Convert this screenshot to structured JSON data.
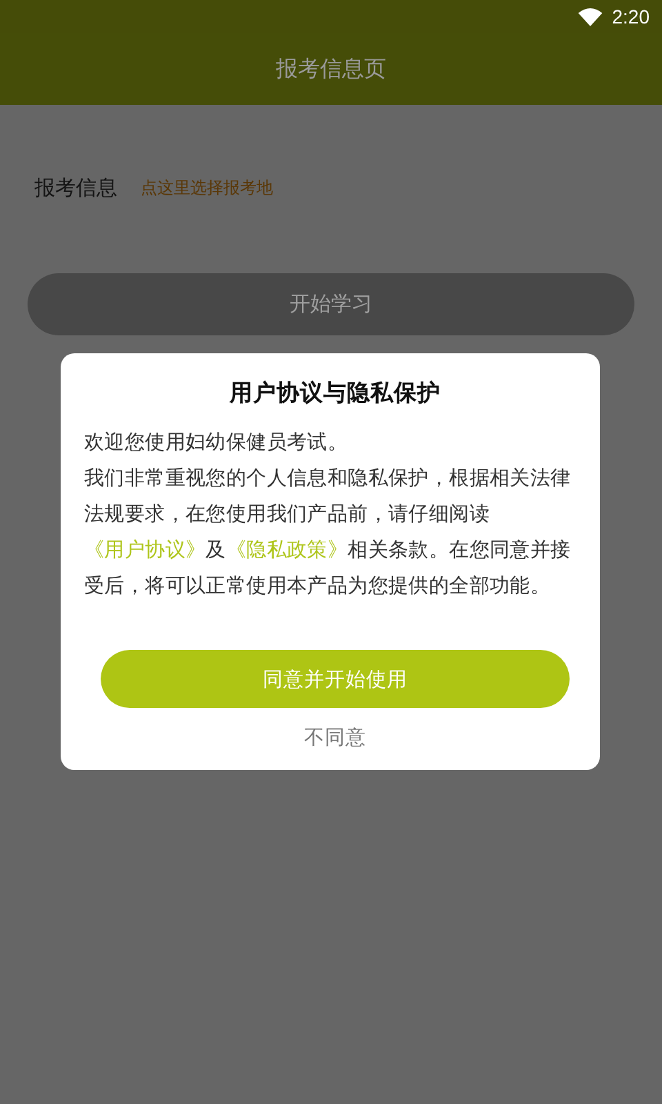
{
  "status_bar": {
    "time": "2:20"
  },
  "app_bar": {
    "title": "报考信息页"
  },
  "form": {
    "label": "报考信息",
    "picker": "点这里选择报考地"
  },
  "start_button": {
    "label": "开始学习"
  },
  "dialog": {
    "title": "用户协议与隐私保护",
    "intro": "欢迎您使用妇幼保健员考试。",
    "body": [
      {
        "kind": "text",
        "text": "我们非常重视您的个人信息和隐私保护，根据相关法律法规要求，在您使用我们产品前，请仔细阅读"
      },
      {
        "kind": "link",
        "text": "《用户协议》"
      },
      {
        "kind": "text",
        "text": "及"
      },
      {
        "kind": "link",
        "text": "《隐私政策》"
      },
      {
        "kind": "text",
        "text": "相关条款。在您同意并接受后，将可以正常使用本产品为您提供的全部功能。"
      }
    ],
    "agree_button": "同意并开始使用",
    "disagree_button": "不同意"
  }
}
